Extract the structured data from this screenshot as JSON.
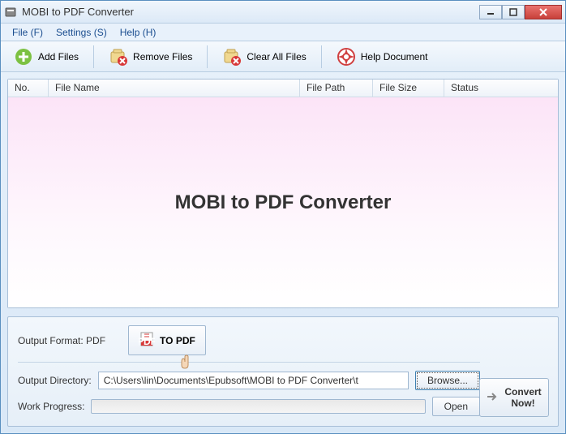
{
  "window": {
    "title": "MOBI to PDF Converter"
  },
  "menu": {
    "file": "File (F)",
    "settings": "Settings (S)",
    "help": "Help (H)"
  },
  "toolbar": {
    "add": "Add Files",
    "remove": "Remove Files",
    "clear": "Clear All Files",
    "help": "Help Document"
  },
  "columns": {
    "no": "No.",
    "name": "File Name",
    "path": "File Path",
    "size": "File Size",
    "status": "Status"
  },
  "watermark": "MOBI to PDF Converter",
  "output": {
    "format_label": "Output Format: PDF",
    "topdf_label": "TO PDF",
    "dir_label": "Output Directory:",
    "dir_value": "C:\\Users\\lin\\Documents\\Epubsoft\\MOBI to PDF Converter\\t",
    "browse": "Browse...",
    "progress_label": "Work Progress:",
    "open": "Open",
    "convert": "Convert Now!"
  }
}
